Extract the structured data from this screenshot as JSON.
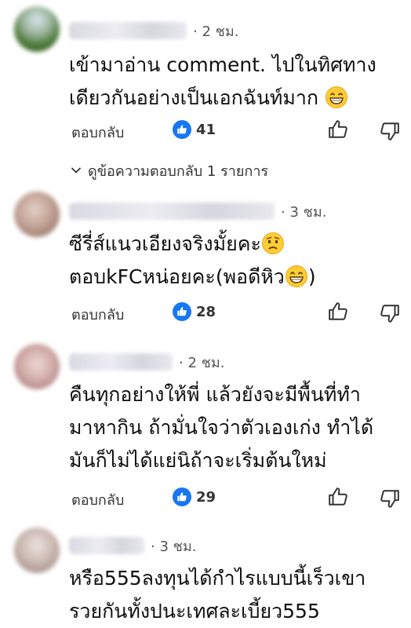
{
  "comments": [
    {
      "time": "· 2 ชม.",
      "lines": [
        "เข้ามาอ่าน comment. ไปในทิศทาง",
        "เดียวกันอย่างเป็นเอกฉันท์มาก"
      ],
      "emoji": "grinning-face",
      "reply_label": "ตอบกลับ",
      "likes": "41",
      "avatar_color": "#6d8f5a"
    },
    {
      "time": "· 3 ชม.",
      "lines": [
        "ซีรี่ส์แนวเอียงจริงมั้ยคะ",
        "ตอบkFCหน่อยคะ(พอดีหิว"
      ],
      "emoji_line1": "slightly-worried-face",
      "emoji_line2": "grinning-face",
      "line2_suffix": ")",
      "reply_label": "ตอบกลับ",
      "likes": "28",
      "avatar_color": "#b89a8e"
    },
    {
      "time": "· 2 ชม.",
      "lines": [
        "คืนทุกอย่างให้พี่ แล้วยังจะมีพื้นที่ทำ",
        "มาหากิน ถ้ามั่นใจว่าตัวเองเก่ง ทำได้",
        "มันก็ไม่ได้แย่นิถ้าจะเริ่มต้นใหม่"
      ],
      "reply_label": "ตอบกลับ",
      "likes": "29",
      "avatar_color": "#c9a7a5"
    },
    {
      "time": "· 3 ชม.",
      "lines": [
        "หรือ555ลงทุนได้กำไรแบบนี้เร็วเขา",
        "รวยกันทั้งปนะเทศละเบี้ยว555"
      ],
      "avatar_color": "#c4b3ad"
    }
  ],
  "view_replies_label": "ดูข้อความตอบกลับ 1 รายการ",
  "colors": {
    "like_badge": "#1877f2",
    "emoji_yellow": "#ffcc33"
  },
  "icons": [
    "thumbs-up-icon",
    "thumbs-down-icon",
    "like-badge-icon",
    "chevron-down-icon"
  ]
}
